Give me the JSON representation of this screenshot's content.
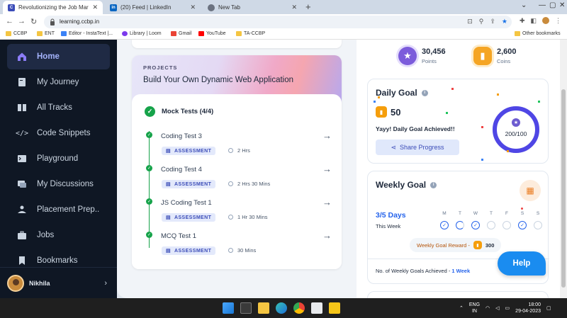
{
  "browser": {
    "tabs": [
      {
        "title": "Revolutionizing the Job Market |",
        "close": "✕"
      },
      {
        "title": "(20) Feed | LinkedIn",
        "close": "✕"
      },
      {
        "title": "New Tab",
        "close": "✕"
      }
    ],
    "url": "learning.ccbp.in",
    "bookmarks": [
      "CCBP",
      "ENT",
      "Editor - InstaText |...",
      "Library | Loom",
      "Gmail",
      "YouTube",
      "TA-CCBP"
    ],
    "other_bookmarks": "Other bookmarks"
  },
  "sidebar": {
    "items": [
      {
        "label": "Home",
        "icon": "home-icon"
      },
      {
        "label": "My Journey",
        "icon": "journey-icon"
      },
      {
        "label": "All Tracks",
        "icon": "tracks-icon"
      },
      {
        "label": "Code Snippets",
        "icon": "code-icon"
      },
      {
        "label": "Playground",
        "icon": "terminal-icon"
      },
      {
        "label": "My Discussions",
        "icon": "discussion-icon"
      },
      {
        "label": "Placement Prep..",
        "icon": "placement-icon"
      },
      {
        "label": "Jobs",
        "icon": "briefcase-icon"
      },
      {
        "label": "Bookmarks",
        "icon": "bookmark-icon"
      }
    ],
    "user": "Nikhila"
  },
  "project": {
    "label": "PROJECTS",
    "title": "Build Your Own Dynamic Web Application",
    "section": "Mock Tests (4/4)",
    "tests": [
      {
        "name": "Coding Test 3",
        "tag": "ASSESSMENT",
        "duration": "2 Hrs"
      },
      {
        "name": "Coding Test 4",
        "tag": "ASSESSMENT",
        "duration": "2 Hrs 30 Mins"
      },
      {
        "name": "JS Coding Test 1",
        "tag": "ASSESSMENT",
        "duration": "1 Hr 30 Mins"
      },
      {
        "name": "MCQ Test 1",
        "tag": "ASSESSMENT",
        "duration": "30 Mins"
      }
    ]
  },
  "stats": {
    "points": "30,456",
    "points_label": "Points",
    "coins": "2,600",
    "coins_label": "Coins"
  },
  "daily_goal": {
    "title": "Daily Goal",
    "coins": "50",
    "message": "Yayy! Daily Goal Achieved!!",
    "share_label": "Share Progress",
    "progress_text": "200/100",
    "progress_fraction": 1.0
  },
  "weekly_goal": {
    "title": "Weekly Goal",
    "days_text": "3/5 Days",
    "this_week": "This Week",
    "weekdays": [
      "M",
      "T",
      "W",
      "T",
      "F",
      "S",
      "S"
    ],
    "day_status": [
      "done",
      "half",
      "done",
      "none",
      "none",
      "done",
      "none"
    ],
    "reward_label": "Weekly Goal Reward -",
    "reward_value": "300",
    "achieved_label": "No. of Weekly Goals Achieved -",
    "achieved_value": "1 Week"
  },
  "help_label": "Help",
  "taskbar": {
    "lang1": "ENG",
    "lang2": "IN",
    "time": "18:00",
    "date": "29-04-2023"
  },
  "colors": {
    "sidebar_bg": "#0f1724",
    "accent": "#2563eb",
    "success": "#16a34a",
    "help": "#1a8cf0"
  }
}
